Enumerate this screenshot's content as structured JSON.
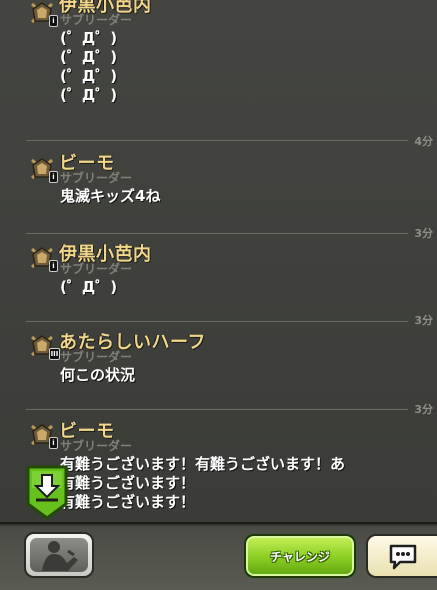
{
  "messages": [
    {
      "sender": "伊黒小芭内",
      "role": "サブリーダー",
      "lines": [
        "(゜Д゜)",
        "(゜Д゜)",
        "(゜Д゜)",
        "(゜Д゜)"
      ],
      "time": "4分"
    },
    {
      "sender": "ビーモ",
      "role": "サブリーダー",
      "lines": [
        "鬼滅キッズ4ね"
      ],
      "time": "3分"
    },
    {
      "sender": "伊黒小芭内",
      "role": "サブリーダー",
      "lines": [
        "(゜Д゜)"
      ],
      "time": "3分"
    },
    {
      "sender": "あたらしいハーフ",
      "role": "サブリーダー",
      "lines": [
        "何この状況"
      ],
      "time": "3分"
    },
    {
      "sender": "ビーモ",
      "role": "サブリーダー",
      "lines": [
        "有難うございます！有難うございます！あ",
        "有難うございます！",
        "有難うございます！"
      ],
      "time": ""
    }
  ],
  "m0_text": "(゜Д゜)\n(゜Д゜)\n(゜Д゜)\n(゜Д゜)",
  "m4_text": "有難うございます！有難うございます！あ\n有難うございます！\n有難うございます！",
  "bottom_bar": {
    "challenge_label": "チャレンジ"
  },
  "icons": {
    "clan_badge": "clan-badge-icon",
    "scroll_down": "download-arrow-icon",
    "friends": "friends-silhouette-icon",
    "chat": "speech-bubble-icon"
  },
  "colors": {
    "sender": "#f2d68a",
    "challenge_green": "#8ed124",
    "background": "#3e3f3a"
  }
}
